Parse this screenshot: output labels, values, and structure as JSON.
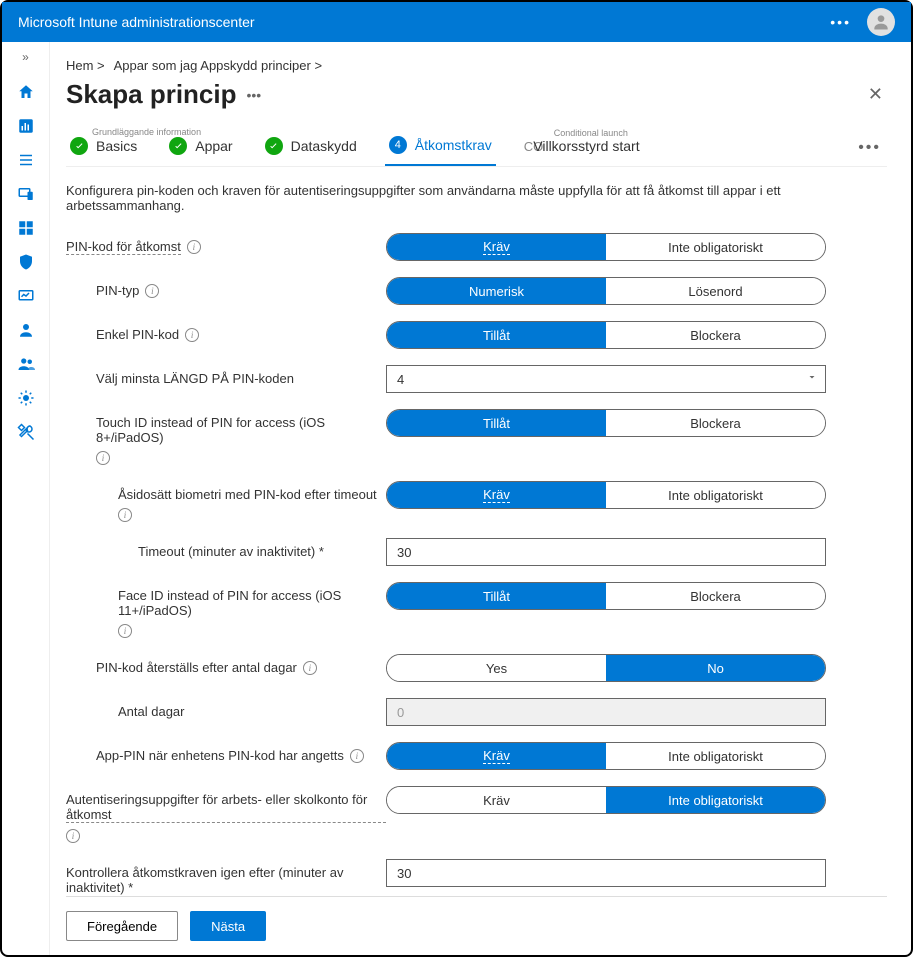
{
  "header": {
    "title": "Microsoft Intune administrationscenter"
  },
  "breadcrumb": {
    "home": "Hem >",
    "apps": "Appar som jag Appskydd principer >"
  },
  "page_title": "Skapa princip",
  "tabs": {
    "t1": {
      "label": "Basics",
      "sub": "Grundläggande information"
    },
    "t2": {
      "label": "Appar"
    },
    "t3": {
      "label": "Dataskydd"
    },
    "t4": {
      "num": "4",
      "label": "Åtkomstkrav"
    },
    "t5": {
      "co": "CO",
      "label": "Villkorsstyrd start",
      "sub": "Conditional launch"
    }
  },
  "desc": "Konfigurera pin-koden och kraven för autentiseringsuppgifter som användarna måste uppfylla för att få åtkomst till appar i ett arbetssammanhang.",
  "labels": {
    "pin_access": "PIN-kod för åtkomst",
    "pin_type": "PIN-typ",
    "simple_pin": "Enkel PIN-kod",
    "min_len": "Välj minsta LÄNGD PÅ PIN-koden",
    "touch_id": "Touch ID instead of PIN for access (iOS 8+/iPadOS)",
    "override_bio": "Åsidosätt biometri med PIN-kod efter timeout",
    "timeout": "Timeout (minuter av inaktivitet) *",
    "face_id": "Face ID instead of PIN for access (iOS 11+/iPadOS)",
    "pin_reset": "PIN-kod återställs efter antal dagar",
    "num_days": "Antal dagar",
    "app_pin": "App-PIN när enhetens PIN-kod har angetts",
    "work_cred": "Autentiseringsuppgifter för arbets- eller skolkonto för åtkomst",
    "recheck": "Kontrollera åtkomstkraven igen efter (minuter av inaktivitet) *"
  },
  "options": {
    "require": "Kräv",
    "not_required": "Inte obligatoriskt",
    "numeric": "Numerisk",
    "passcode": "Lösenord",
    "allow": "Tillåt",
    "block": "Blockera",
    "yes": "Yes",
    "no": "No"
  },
  "values": {
    "min_len": "4",
    "timeout": "30",
    "num_days": "0",
    "recheck": "30"
  },
  "buttons": {
    "prev": "Föregående",
    "next": "Nästa"
  }
}
